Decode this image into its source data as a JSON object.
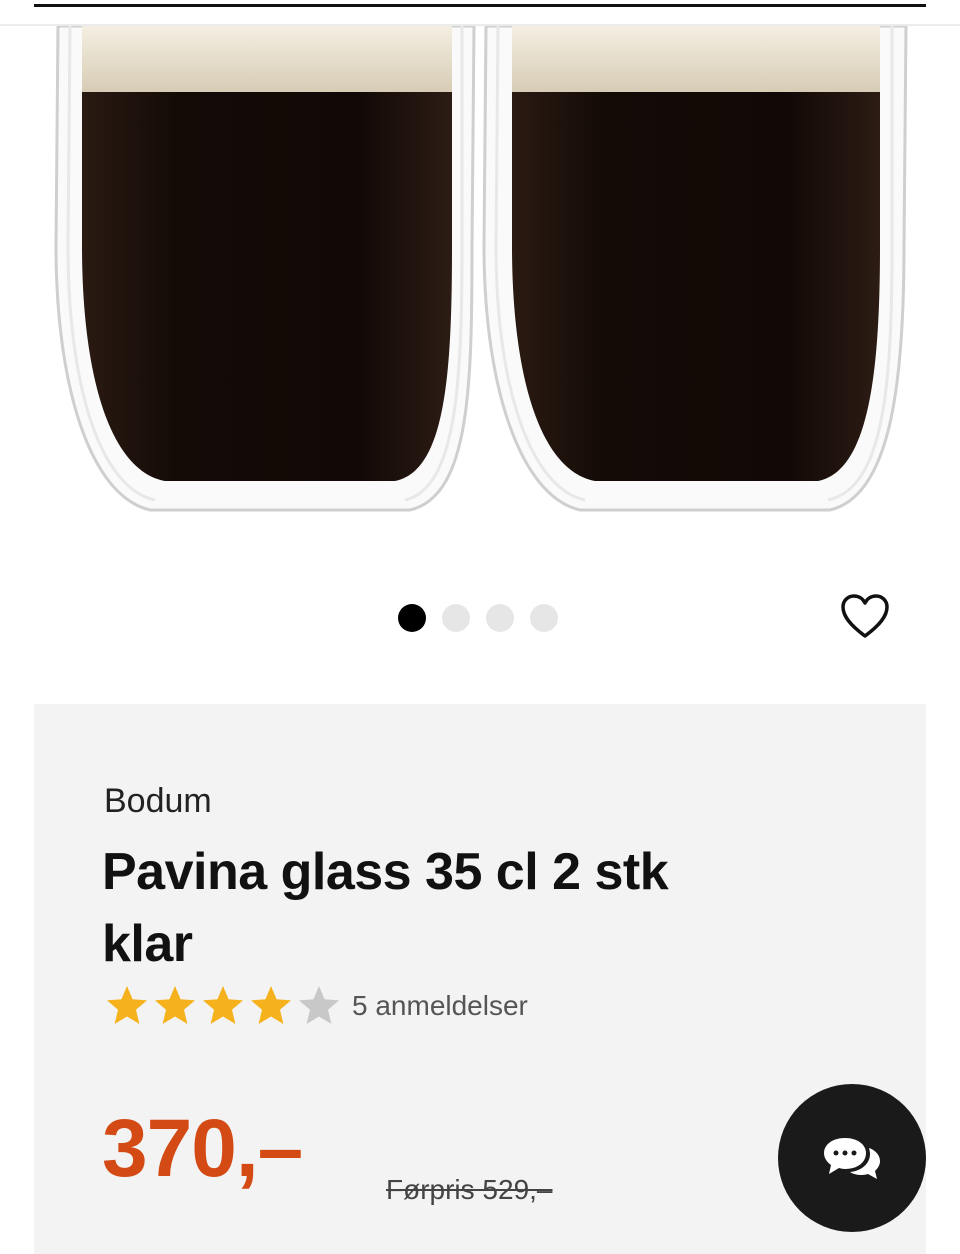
{
  "product": {
    "brand": "Bodum",
    "title": "Pavina glass 35 cl 2 stk klar",
    "rating": 4,
    "rating_max": 5,
    "reviews_label": "5 anmeldelser",
    "price": "370,–",
    "previous_price": "Førpris 529,–"
  },
  "gallery": {
    "image_count": 4,
    "active_index": 0
  },
  "icons": {
    "wishlist": "heart-outline-icon",
    "chat": "chat-bubbles-icon",
    "star_filled": "star-filled-icon",
    "star_empty": "star-empty-icon"
  },
  "colors": {
    "price": "#d34a14",
    "star_filled": "#f6b21c",
    "star_empty": "#c8c8c8",
    "panel_background": "#f3f3f3",
    "chat_button": "#1a1a1a"
  }
}
